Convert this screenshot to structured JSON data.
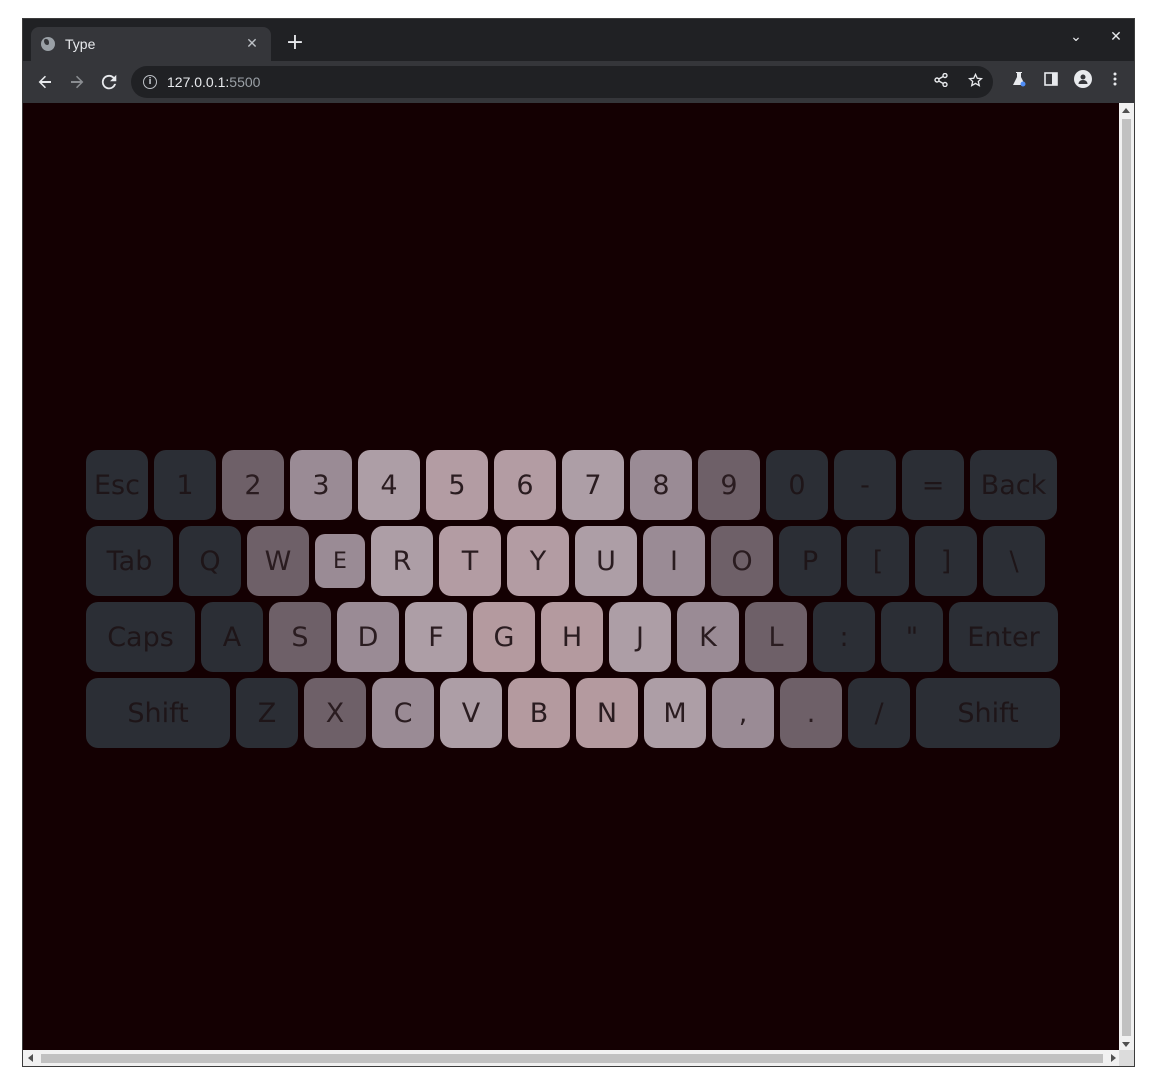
{
  "browser": {
    "tab_title": "Type",
    "tab_close": "✕",
    "new_tab": "+",
    "url_host": "127.0.0.1:",
    "url_port": "5500",
    "window_controls": {
      "dropdown": "⌄",
      "close": "✕"
    }
  },
  "keyboard": {
    "rows": [
      [
        {
          "label": "Esc",
          "w": 62,
          "c": "c0"
        },
        {
          "label": "1",
          "w": 62,
          "c": "c0"
        },
        {
          "label": "2",
          "w": 62,
          "c": "c1"
        },
        {
          "label": "3",
          "w": 62,
          "c": "c2"
        },
        {
          "label": "4",
          "w": 62,
          "c": "c3"
        },
        {
          "label": "5",
          "w": 62,
          "c": "c4"
        },
        {
          "label": "6",
          "w": 62,
          "c": "c4"
        },
        {
          "label": "7",
          "w": 62,
          "c": "c3"
        },
        {
          "label": "8",
          "w": 62,
          "c": "c2"
        },
        {
          "label": "9",
          "w": 62,
          "c": "c1"
        },
        {
          "label": "0",
          "w": 62,
          "c": "c0"
        },
        {
          "label": "-",
          "w": 62,
          "c": "c0"
        },
        {
          "label": "=",
          "w": 62,
          "c": "c0"
        },
        {
          "label": "Back",
          "w": 87,
          "c": "c0"
        }
      ],
      [
        {
          "label": "Tab",
          "w": 87,
          "c": "c0"
        },
        {
          "label": "Q",
          "w": 62,
          "c": "c0"
        },
        {
          "label": "W",
          "w": 62,
          "c": "c1"
        },
        {
          "label": "E",
          "w": 50,
          "c": "c2",
          "small": true
        },
        {
          "label": "R",
          "w": 62,
          "c": "c3"
        },
        {
          "label": "T",
          "w": 62,
          "c": "c4"
        },
        {
          "label": "Y",
          "w": 62,
          "c": "c4"
        },
        {
          "label": "U",
          "w": 62,
          "c": "c3"
        },
        {
          "label": "I",
          "w": 62,
          "c": "c2"
        },
        {
          "label": "O",
          "w": 62,
          "c": "c1"
        },
        {
          "label": "P",
          "w": 62,
          "c": "c0"
        },
        {
          "label": "[",
          "w": 62,
          "c": "c0"
        },
        {
          "label": "]",
          "w": 62,
          "c": "c0"
        },
        {
          "label": "\\",
          "w": 62,
          "c": "c0"
        }
      ],
      [
        {
          "label": "Caps",
          "w": 109,
          "c": "c0"
        },
        {
          "label": "A",
          "w": 62,
          "c": "c0"
        },
        {
          "label": "S",
          "w": 62,
          "c": "c1"
        },
        {
          "label": "D",
          "w": 62,
          "c": "c2"
        },
        {
          "label": "F",
          "w": 62,
          "c": "c3"
        },
        {
          "label": "G",
          "w": 62,
          "c": "c5"
        },
        {
          "label": "H",
          "w": 62,
          "c": "c5"
        },
        {
          "label": "J",
          "w": 62,
          "c": "c3"
        },
        {
          "label": "K",
          "w": 62,
          "c": "c2"
        },
        {
          "label": "L",
          "w": 62,
          "c": "c1"
        },
        {
          "label": ":",
          "w": 62,
          "c": "c0"
        },
        {
          "label": "\"",
          "w": 62,
          "c": "c0"
        },
        {
          "label": "Enter",
          "w": 109,
          "c": "c0"
        }
      ],
      [
        {
          "label": "Shift",
          "w": 144,
          "c": "c0"
        },
        {
          "label": "Z",
          "w": 62,
          "c": "c0"
        },
        {
          "label": "X",
          "w": 62,
          "c": "c1"
        },
        {
          "label": "C",
          "w": 62,
          "c": "c2"
        },
        {
          "label": "V",
          "w": 62,
          "c": "c3"
        },
        {
          "label": "B",
          "w": 62,
          "c": "c5"
        },
        {
          "label": "N",
          "w": 62,
          "c": "c5"
        },
        {
          "label": "M",
          "w": 62,
          "c": "c3"
        },
        {
          "label": ",",
          "w": 62,
          "c": "c2"
        },
        {
          "label": ".",
          "w": 62,
          "c": "c1"
        },
        {
          "label": "/",
          "w": 62,
          "c": "c0"
        },
        {
          "label": "Shift",
          "w": 144,
          "c": "c0"
        }
      ]
    ]
  }
}
